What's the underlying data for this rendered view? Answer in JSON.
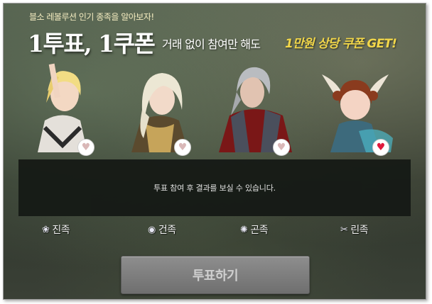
{
  "header": {
    "subtitle": "블소 레볼루션 인기 종족을 알아보자!",
    "title": "1투표, 1쿠폰",
    "description": "거래 없이 참여만 해도",
    "highlight": "1만원 상당 쿠폰 GET!"
  },
  "characters": [
    {
      "name": "진족",
      "heart": "♥",
      "selected": false
    },
    {
      "name": "건족",
      "heart": "♥",
      "selected": false
    },
    {
      "name": "곤족",
      "heart": "♥",
      "selected": false
    },
    {
      "name": "린족",
      "heart": "♥",
      "selected": true
    }
  ],
  "overlay": {
    "message": "투표 참여 후 결과를 보실 수 있습니다."
  },
  "clan_icons": {
    "jin": "❀",
    "gun": "◉",
    "gon": "✺",
    "lyn": "✂"
  },
  "button": {
    "label": "투표하기"
  },
  "colors": {
    "highlight": "#f1d64a",
    "heart_selected": "#e0193c",
    "heart_unselected": "#d9b7b7"
  }
}
